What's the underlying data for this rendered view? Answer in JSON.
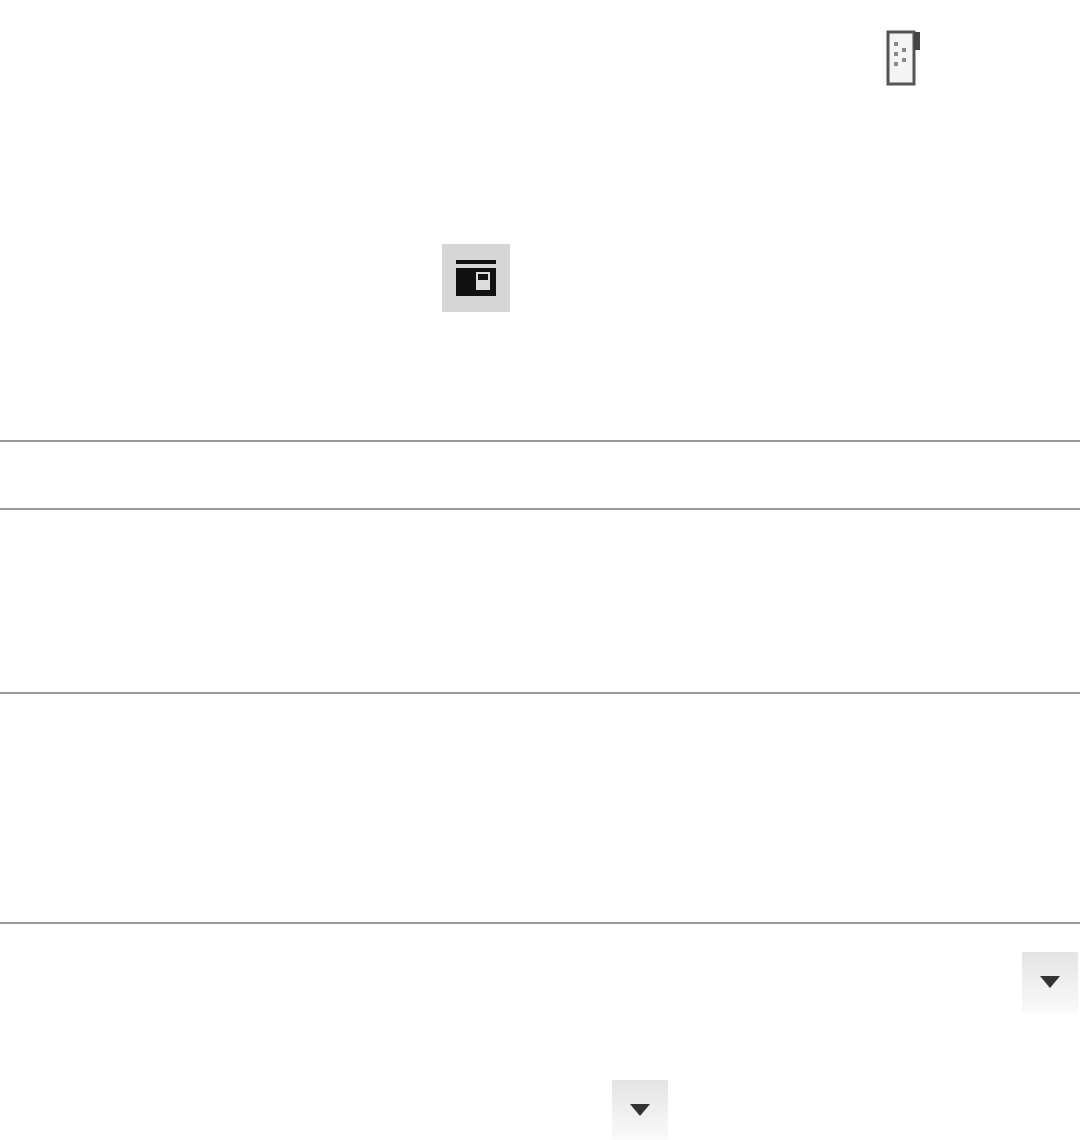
{
  "toolbar_buttons": [
    {
      "kind": "document",
      "selected": false
    },
    {
      "kind": "layout",
      "selected": true
    }
  ],
  "dropdown_buttons": [
    {
      "kind": "dropdown"
    },
    {
      "kind": "dropdown"
    }
  ]
}
